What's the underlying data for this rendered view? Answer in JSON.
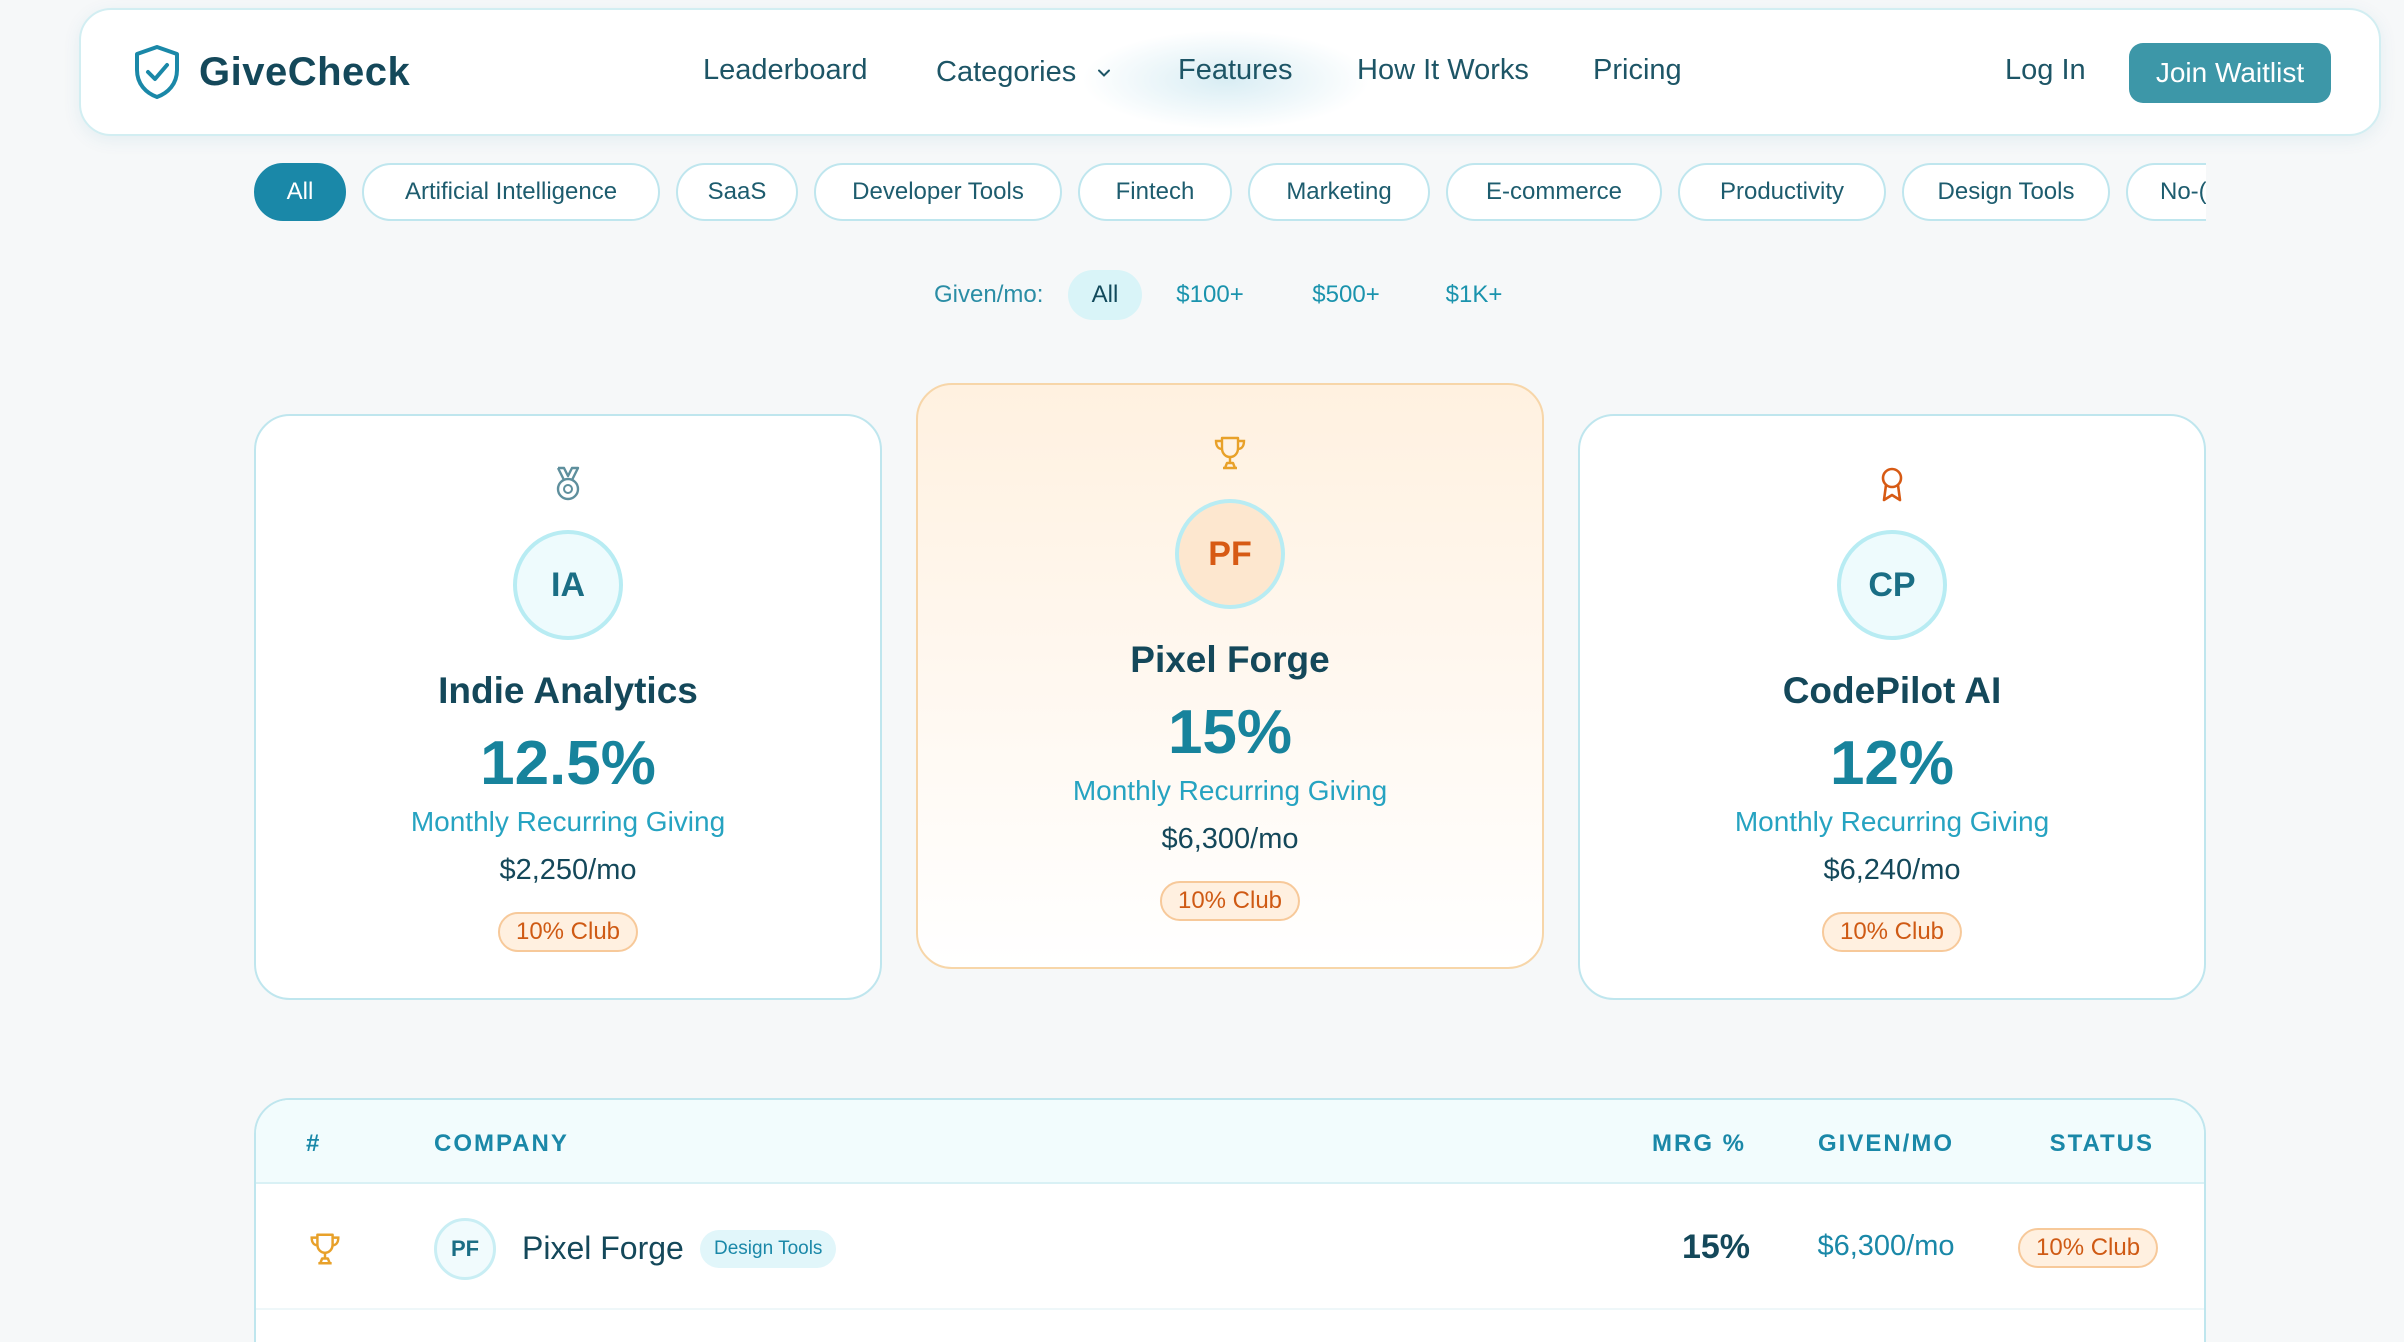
{
  "brand": {
    "name": "GiveCheck",
    "icon": "shield-check-icon"
  },
  "nav": {
    "links": [
      "Leaderboard",
      "Categories",
      "Features",
      "How It Works",
      "Pricing"
    ],
    "login": "Log In",
    "cta": "Join Waitlist"
  },
  "categories": [
    "All",
    "Artificial Intelligence",
    "SaaS",
    "Developer Tools",
    "Fintech",
    "Marketing",
    "E-commerce",
    "Productivity",
    "Design Tools",
    "No-("
  ],
  "active_category": "All",
  "given_filter": {
    "label": "Given/mo:",
    "options": [
      "All",
      "$100+",
      "$500+",
      "$1K+"
    ],
    "active": "All"
  },
  "podium": [
    {
      "rank_icon": "medal-icon",
      "initials": "IA",
      "name": "Indie Analytics",
      "pct": "12.5%",
      "metric": "Monthly Recurring Giving",
      "amount": "$2,250/mo",
      "badge": "10% Club"
    },
    {
      "rank_icon": "trophy-icon",
      "initials": "PF",
      "name": "Pixel Forge",
      "pct": "15%",
      "metric": "Monthly Recurring Giving",
      "amount": "$6,300/mo",
      "badge": "10% Club"
    },
    {
      "rank_icon": "award-ribbon-icon",
      "initials": "CP",
      "name": "CodePilot AI",
      "pct": "12%",
      "metric": "Monthly Recurring Giving",
      "amount": "$6,240/mo",
      "badge": "10% Club"
    }
  ],
  "table": {
    "headers": [
      "#",
      "COMPANY",
      "MRG %",
      "GIVEN/MO",
      "STATUS"
    ],
    "rows": [
      {
        "rank_icon": "trophy-icon",
        "initials": "PF",
        "company": "Pixel Forge",
        "category": "Design Tools",
        "pct": "15%",
        "given": "$6,300/mo",
        "status": "10% Club"
      }
    ]
  },
  "colors": {
    "accent": "#1a88a8",
    "cta": "#3d97a8",
    "gold": "#e8a12a",
    "badge_text": "#cf5a14"
  }
}
